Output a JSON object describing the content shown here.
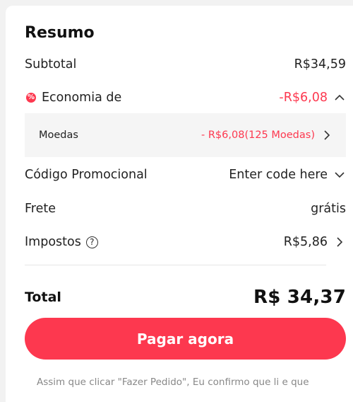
{
  "summary": {
    "title": "Resumo",
    "subtotal": {
      "label": "Subtotal",
      "value": "R$34,59"
    },
    "savings": {
      "label": "Economia de",
      "value": "-R$6,08",
      "badge": "%"
    },
    "coins": {
      "label": "Moedas",
      "value": "- R$6,08(125 Moedas)"
    },
    "promo": {
      "label": "Código Promocional",
      "placeholder": "Enter code here"
    },
    "shipping": {
      "label": "Frete",
      "value": "grátis"
    },
    "taxes": {
      "label": "Impostos",
      "help": "?",
      "value": "R$5,86"
    },
    "total": {
      "label": "Total",
      "value": "R$ 34,37"
    },
    "pay_button": "Pagar agora",
    "disclaimer": "Assim que clicar \"Fazer Pedido\", Eu confirmo que li e que"
  },
  "colors": {
    "accent": "#fd384f"
  },
  "icons": [
    "chevron-up-icon",
    "chevron-right-icon",
    "chevron-down-icon",
    "help-circle-icon",
    "discount-icon"
  ]
}
